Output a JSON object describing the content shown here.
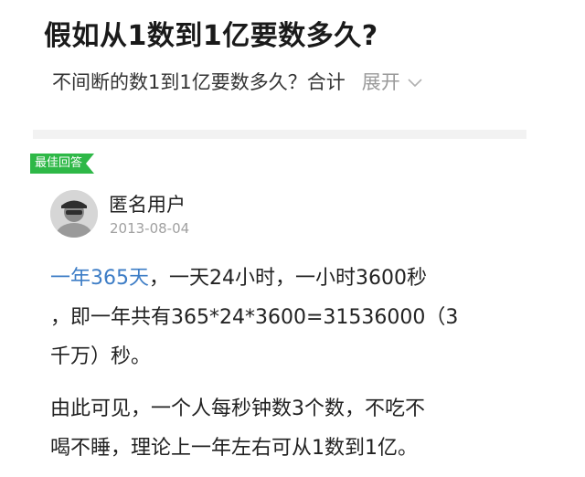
{
  "question": {
    "title": "假如从1数到1亿要数多久?",
    "description": "不间断的数1到1亿要数多久？合计",
    "expand_label": "展开"
  },
  "answer": {
    "badge": "最佳回答",
    "user_name": "匿名用户",
    "date": "2013-08-04",
    "link_text": "一年365天",
    "para1_line1_rest": "，一天24小时，一小时3600秒",
    "para1_line2": "，即一年共有365*24*3600=31536000（3",
    "para1_line3": "千万）秒。",
    "para2_line1": "由此可见，一个人每秒钟数3个数，不吃不",
    "para2_line2": "喝不睡，理论上一年左右可从1数到1亿。"
  },
  "colors": {
    "badge_green": "#2eb847",
    "link_blue": "#3d7dc6",
    "muted_gray": "#a0a0a0"
  },
  "icons": {
    "expand": "chevron-down-icon",
    "avatar": "anonymous-user-avatar"
  }
}
